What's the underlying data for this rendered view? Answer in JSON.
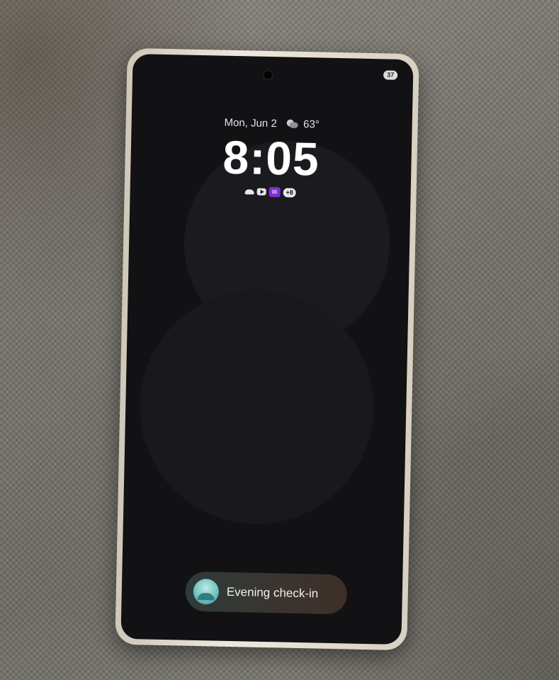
{
  "status_bar": {
    "battery": "37"
  },
  "lock_screen": {
    "date": "Mon, Jun 2",
    "weather": {
      "icon": "partly-cloudy-night-icon",
      "temperature": "63°"
    },
    "time": "8:05",
    "notification_icons": [
      "cloud-icon",
      "youtube-icon",
      "purple-app-icon",
      "more-notifications-icon"
    ],
    "more_notifications_count": "+8"
  },
  "checkin_chip": {
    "label": "Evening check-in",
    "icon": "sunset-icon"
  },
  "colors": {
    "screen_background": "#121114",
    "app_icon_purple": "#7b2fd6",
    "chip_icon_teal": "#6fc3c0"
  }
}
